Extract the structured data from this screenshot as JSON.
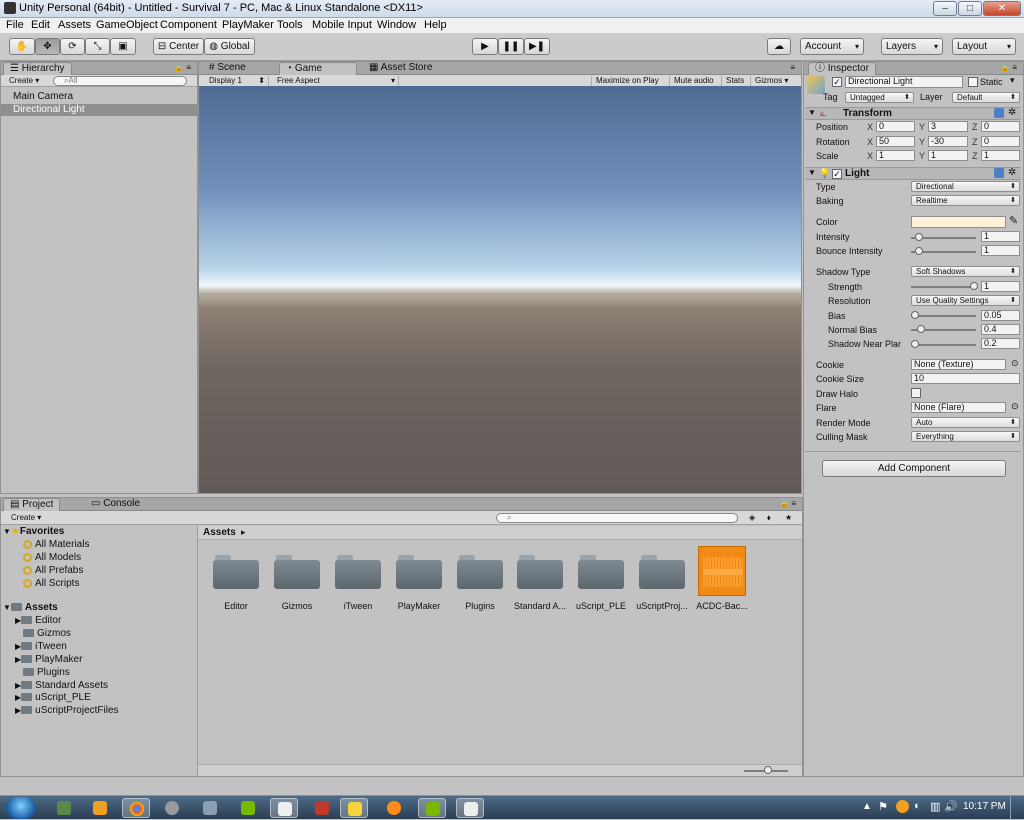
{
  "window": {
    "title": "Unity Personal (64bit) - Untitled - Survival 7 - PC, Mac & Linux Standalone <DX11>",
    "controls": [
      "–",
      "□",
      "✕"
    ]
  },
  "menu": [
    "File",
    "Edit",
    "Assets",
    "GameObject",
    "Component",
    "PlayMaker",
    "Tools",
    "Mobile Input",
    "Window",
    "Help"
  ],
  "toolbar": {
    "pivot": "Center",
    "space": "Global",
    "account": "Account",
    "layers": "Layers",
    "layout": "Layout"
  },
  "hierarchy": {
    "tab": "Hierarchy",
    "create": "Create",
    "search_placeholder": "All",
    "items": [
      "Main Camera",
      "Directional Light"
    ]
  },
  "center": {
    "tabs": [
      "Scene",
      "Game",
      "Asset Store"
    ],
    "display": "Display 1",
    "aspect": "Free Aspect",
    "options": [
      "Maximize on Play",
      "Mute audio",
      "Stats",
      "Gizmos"
    ]
  },
  "inspector": {
    "tab": "Inspector",
    "object_name": "Directional Light",
    "static_label": "Static",
    "tag_label": "Tag",
    "tag": "Untagged",
    "layer_label": "Layer",
    "layer": "Default",
    "transform": {
      "title": "Transform",
      "rows": [
        {
          "label": "Position",
          "x": "0",
          "y": "3",
          "z": "0"
        },
        {
          "label": "Rotation",
          "x": "50",
          "y": "-30",
          "z": "0"
        },
        {
          "label": "Scale",
          "x": "1",
          "y": "1",
          "z": "1"
        }
      ]
    },
    "light": {
      "title": "Light",
      "type_label": "Type",
      "type": "Directional",
      "baking_label": "Baking",
      "baking": "Realtime",
      "color_label": "Color",
      "color": "#fdf1d9",
      "intensity_label": "Intensity",
      "intensity": "1",
      "bounce_label": "Bounce Intensity",
      "bounce": "1",
      "shadow_type_label": "Shadow Type",
      "shadow_type": "Soft Shadows",
      "strength_label": "Strength",
      "strength": "1",
      "resolution_label": "Resolution",
      "resolution": "Use Quality Settings",
      "bias_label": "Bias",
      "bias": "0.05",
      "normal_bias_label": "Normal Bias",
      "normal_bias": "0.4",
      "near_plane_label": "Shadow Near Plar",
      "near_plane": "0.2",
      "cookie_label": "Cookie",
      "cookie": "None (Texture)",
      "cookie_size_label": "Cookie Size",
      "cookie_size": "10",
      "draw_halo_label": "Draw Halo",
      "flare_label": "Flare",
      "flare": "None (Flare)",
      "render_mode_label": "Render Mode",
      "render_mode": "Auto",
      "culling_label": "Culling Mask",
      "culling": "Everything"
    },
    "add_component": "Add Component"
  },
  "project": {
    "tabs": [
      "Project",
      "Console"
    ],
    "create": "Create",
    "favorites": {
      "title": "Favorites",
      "items": [
        "All Materials",
        "All Models",
        "All Prefabs",
        "All Scripts"
      ]
    },
    "assets_title": "Assets",
    "tree": [
      "Editor",
      "Gizmos",
      "iTween",
      "PlayMaker",
      "Plugins",
      "Standard Assets",
      "uScript_PLE",
      "uScriptProjectFiles"
    ],
    "breadcrumb": "Assets",
    "grid": [
      "Editor",
      "Gizmos",
      "iTween",
      "PlayMaker",
      "Plugins",
      "Standard A...",
      "uScript_PLE",
      "uScriptProj...",
      "ACDC-Bac..."
    ]
  },
  "taskbar": {
    "time": "10:17 PM"
  }
}
